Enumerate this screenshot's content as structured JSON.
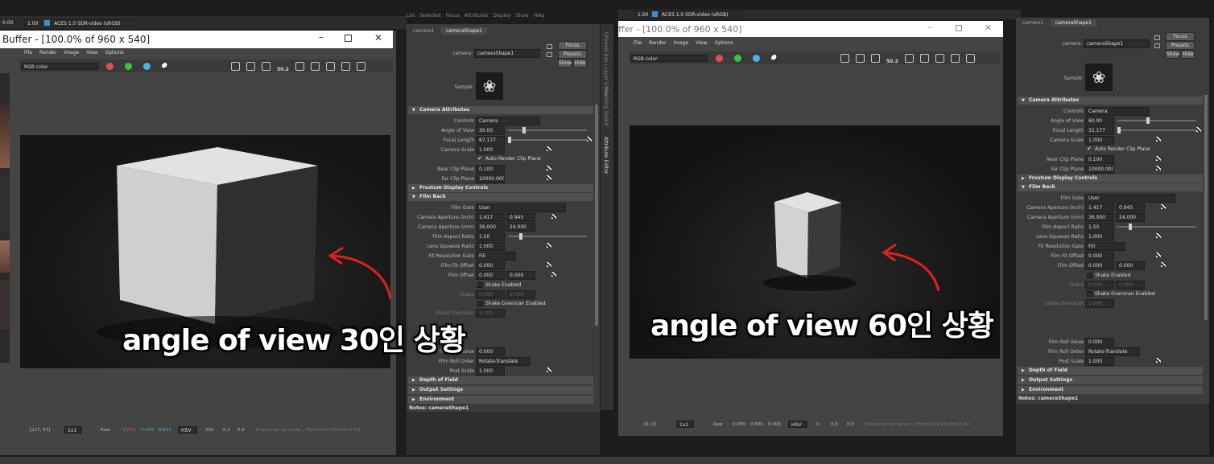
{
  "left": {
    "toolbar": {
      "value1": "0.00",
      "value2": "1.00",
      "colorspace": "ACES 1.0 SDR-video (sRGB)"
    },
    "window_title": "Buffer - [100.0% of 960 x 540]",
    "menu": [
      "File",
      "Render",
      "Image",
      "View",
      "Options"
    ],
    "channel_select": "RGB color",
    "exposure_icon": "50.2",
    "status": {
      "coords": "[217, 57]",
      "zoom": "1x1",
      "raw": "Raw",
      "r": "0.009",
      "g": "0.009",
      "b": "0.011",
      "mode": "HSV",
      "h": "231",
      "s": "0.2",
      "v": "0.0",
      "message": "Preparing ray server... Finished in [0h:0m:0.0s]"
    },
    "overlay": "angle of view 30인 상황"
  },
  "left_attr": {
    "top_menu": [
      "List",
      "Selected",
      "Focus",
      "Attributes",
      "Display",
      "Show",
      "Help"
    ],
    "tabs": [
      "camera1",
      "cameraShape1"
    ],
    "camera_label": "camera:",
    "camera_value": "cameraShape1",
    "buttons": {
      "focus": "Focus",
      "presets": "Presets",
      "show": "Show",
      "hide": "Hide"
    },
    "sample_label": "Sample",
    "sections": {
      "camera_attributes": "Camera Attributes",
      "frustum": "Frustum Display Controls",
      "film_back": "Film Back",
      "depth": "Depth of Field",
      "output": "Output Settings",
      "environment": "Environment"
    },
    "controls": {
      "label": "Controls",
      "value": "Camera"
    },
    "angle": {
      "label": "Angle of View",
      "value": "30.00"
    },
    "focal": {
      "label": "Focal Length",
      "value": "67.177"
    },
    "scale": {
      "label": "Camera Scale",
      "value": "1.000"
    },
    "auto_clip": "Auto Render Clip Plane",
    "near": {
      "label": "Near Clip Plane",
      "value": "0.100"
    },
    "far": {
      "label": "Far Clip Plane",
      "value": "10000.000"
    },
    "film_gate": {
      "label": "Film Gate",
      "value": "User"
    },
    "ap_inch": {
      "label": "Camera Aperture (inch)",
      "v1": "1.417",
      "v2": "0.945"
    },
    "ap_mm": {
      "label": "Camera Aperture (mm)",
      "v1": "36.000",
      "v2": "24.000"
    },
    "aspect": {
      "label": "Film Aspect Ratio",
      "value": "1.50"
    },
    "squeeze": {
      "label": "Lens Squeeze Ratio",
      "value": "1.000"
    },
    "fit_gate": {
      "label": "Fit Resolution Gate",
      "value": "Fill"
    },
    "fit_offset": {
      "label": "Film Fit Offset",
      "value": "0.000"
    },
    "film_offset": {
      "label": "Film Offset",
      "v1": "0.000",
      "v2": "0.000"
    },
    "shake_enabled": "Shake Enabled",
    "shake": {
      "label": "Shake",
      "v1": "0.000",
      "v2": "0.000"
    },
    "shake_overscan_enabled": "Shake Overscan Enabled",
    "shake_overscan": {
      "label": "Shake Overscan",
      "value": "1.000"
    },
    "roll_value": {
      "label": "Film Roll Value",
      "value": "0.000"
    },
    "roll_order": {
      "label": "Film Roll Order",
      "value": "Rotate-Translate"
    },
    "post_scale": {
      "label": "Post Scale",
      "value": "1.000"
    },
    "notes": "Notes: cameraShape1",
    "side_tabs": [
      "Channel Box / Layer Editor",
      "Modeling Toolkit",
      "Attribute Editor"
    ]
  },
  "right": {
    "toolbar": {
      "value2": "1.00",
      "colorspace": "ACES 1.0 SDR-video (sRGB)"
    },
    "window_title": "ffer - [100.0% of 960 x 540]",
    "menu": [
      "File",
      "Render",
      "Image",
      "View",
      "Options"
    ],
    "channel_select": "RGB color",
    "exposure_icon": "50.2",
    "status": {
      "coords": "[0, 0]",
      "zoom": "1x1",
      "raw": "Raw",
      "r": "0.000",
      "g": "0.000",
      "b": "0.000",
      "mode": "HSV",
      "h": "0",
      "s": "0.0",
      "v": "0.0",
      "message": "Preparing ray server... Finished in [0h:0m:0.0s]"
    },
    "overlay": "angle of view 60인 상황"
  },
  "right_attr": {
    "tabs": [
      "camera1",
      "cameraShape1"
    ],
    "camera_label": "camera:",
    "camera_value": "cameraShape1",
    "buttons": {
      "focus": "Focus",
      "presets": "Presets",
      "show": "Show",
      "hide": "Hide"
    },
    "sample_label": "Sample",
    "sections": {
      "camera_attributes": "Camera Attributes",
      "frustum": "Frustum Display Controls",
      "film_back": "Film Back",
      "depth": "Depth of Field",
      "output": "Output Settings",
      "environment": "Environment"
    },
    "controls": {
      "label": "Controls",
      "value": "Camera"
    },
    "angle": {
      "label": "Angle of View",
      "value": "60.00"
    },
    "focal": {
      "label": "Focal Length",
      "value": "31.177"
    },
    "scale": {
      "label": "Camera Scale",
      "value": "1.000"
    },
    "auto_clip": "Auto Render Clip Plane",
    "near": {
      "label": "Near Clip Plane",
      "value": "0.100"
    },
    "far": {
      "label": "Far Clip Plane",
      "value": "10000.000"
    },
    "film_gate": {
      "label": "Film Gate",
      "value": "User"
    },
    "ap_inch": {
      "label": "Camera Aperture (inch)",
      "v1": "1.417",
      "v2": "0.945"
    },
    "ap_mm": {
      "label": "Camera Aperture (mm)",
      "v1": "36.000",
      "v2": "24.000"
    },
    "aspect": {
      "label": "Film Aspect Ratio",
      "value": "1.50"
    },
    "squeeze": {
      "label": "Lens Squeeze Ratio",
      "value": "1.000"
    },
    "fit_gate": {
      "label": "Fit Resolution Gate",
      "value": "Fill"
    },
    "fit_offset": {
      "label": "Film Fit Offset",
      "value": "0.000"
    },
    "film_offset": {
      "label": "Film Offset",
      "v1": "0.000",
      "v2": "0.000"
    },
    "shake_enabled": "Shake Enabled",
    "shake": {
      "label": "Shake",
      "v1": "0.000",
      "v2": "0.000"
    },
    "shake_overscan_enabled": "Shake Overscan Enabled",
    "shake_overscan": {
      "label": "Shake Overscan",
      "value": "1.000"
    },
    "roll_value": {
      "label": "Film Roll Value",
      "value": "0.000"
    },
    "roll_order": {
      "label": "Film Roll Order",
      "value": "Rotate-Translate"
    },
    "post_scale": {
      "label": "Post Scale",
      "value": "1.000"
    },
    "notes": "Notes: cameraShape1"
  },
  "colors": {
    "accent_red": "#e05050",
    "accent_green": "#3cc24a",
    "accent_blue": "#4fb0e6",
    "annotation_arrow": "#e02020",
    "bottom_strip": "#3a3a3a"
  }
}
